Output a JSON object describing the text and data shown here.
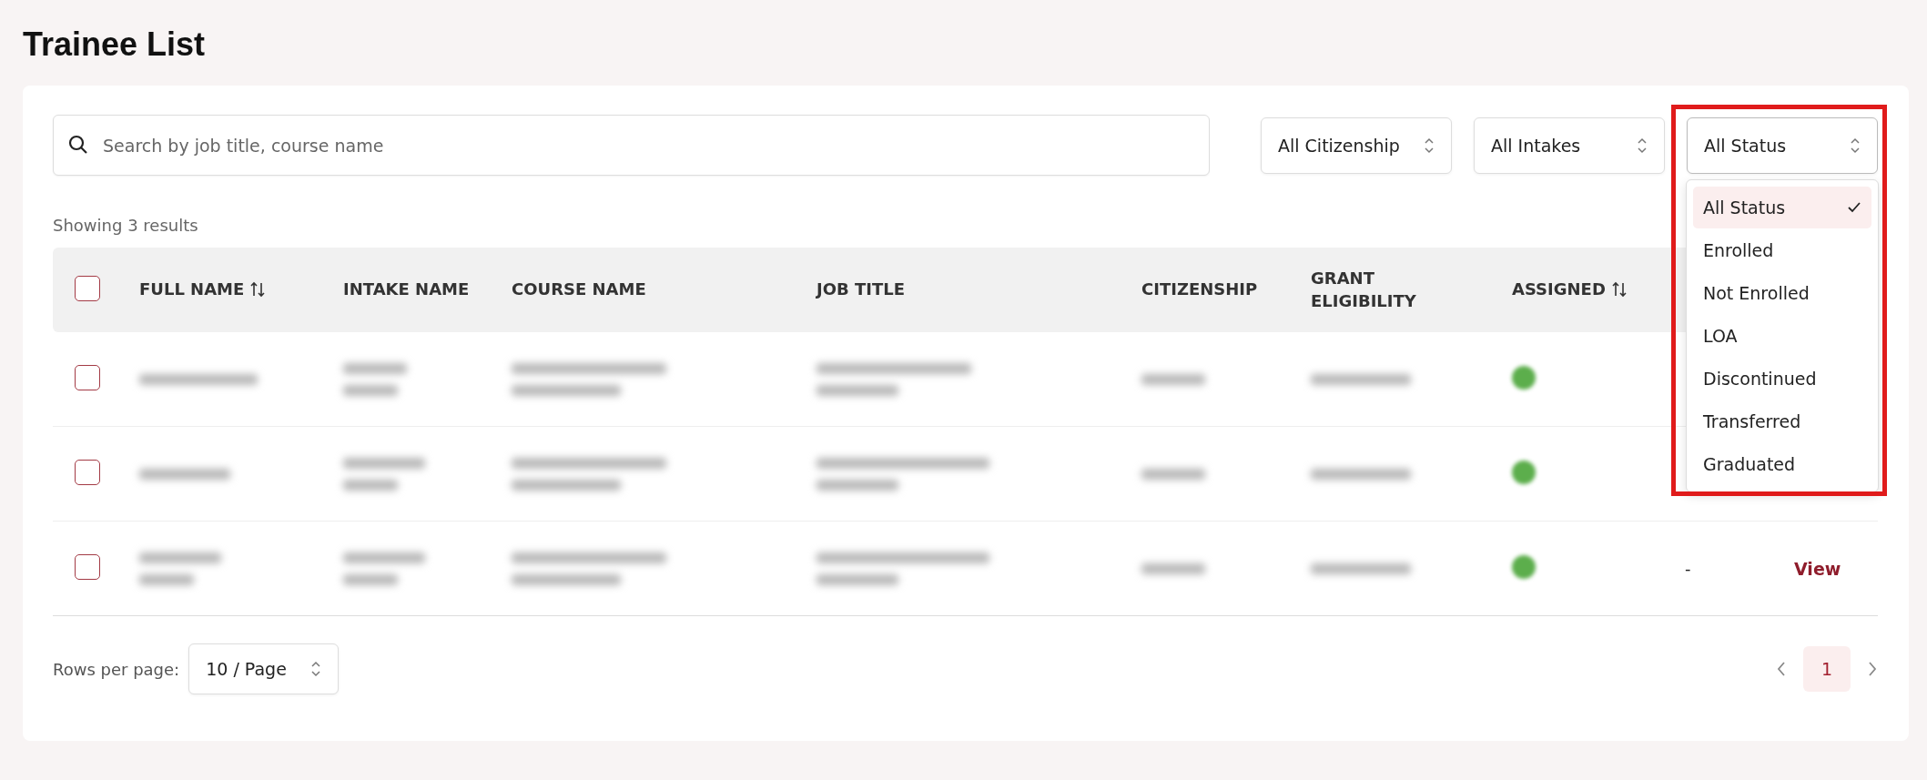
{
  "page_title": "Trainee List",
  "search": {
    "placeholder": "Search by job title, course name"
  },
  "filters": [
    {
      "value": "All Citizenship",
      "open": false
    },
    {
      "value": "All Intakes",
      "open": false
    },
    {
      "value": "All Status",
      "open": true,
      "highlighted": true,
      "options": [
        {
          "label": "All Status",
          "selected": true
        },
        {
          "label": "Enrolled",
          "selected": false
        },
        {
          "label": "Not Enrolled",
          "selected": false
        },
        {
          "label": "LOA",
          "selected": false
        },
        {
          "label": "Discontinued",
          "selected": false
        },
        {
          "label": "Transferred",
          "selected": false
        },
        {
          "label": "Graduated",
          "selected": false
        }
      ]
    }
  ],
  "results_text": "Showing 3 results",
  "table": {
    "select_all_checked": false,
    "columns": [
      {
        "label": "FULL NAME",
        "sortable": true
      },
      {
        "label": "INTAKE NAME",
        "sortable": false
      },
      {
        "label": "COURSE NAME",
        "sortable": false
      },
      {
        "label": "JOB TITLE",
        "sortable": false
      },
      {
        "label": "CITIZENSHIP",
        "sortable": false
      },
      {
        "label": "GRANT ELIGIBILITY",
        "sortable": false
      },
      {
        "label": "ASSIGNED",
        "sortable": true
      }
    ],
    "rows": [
      {
        "checked": false,
        "assigned": true
      },
      {
        "checked": false,
        "assigned": true
      },
      {
        "checked": false,
        "assigned": true,
        "status": "-",
        "action": "View"
      }
    ]
  },
  "footer": {
    "rows_per_page_label": "Rows per page:",
    "rows_per_page": "10 / Page",
    "pages": [
      {
        "label": "1",
        "selected": true
      }
    ]
  }
}
